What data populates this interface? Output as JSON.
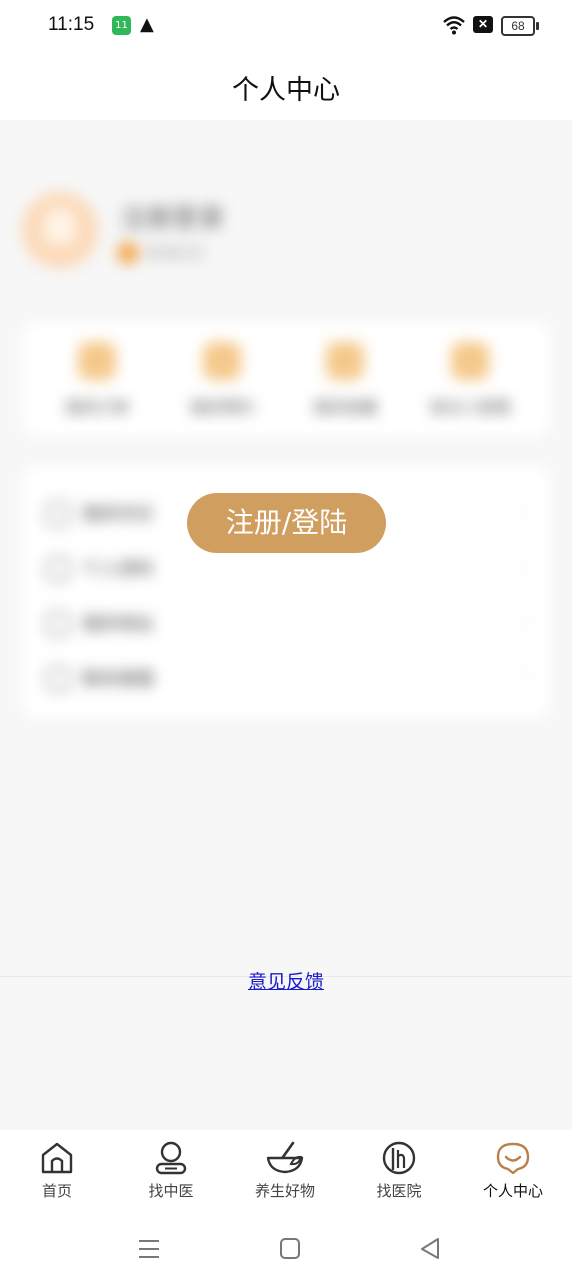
{
  "status_bar": {
    "time": "11:15",
    "app_badge": "11",
    "warning_icon": "warning-icon",
    "battery": "68"
  },
  "header": {
    "title": "个人中心"
  },
  "profile": {
    "nickname": "注册登录",
    "level": "普通会员"
  },
  "quick_actions": [
    {
      "label": "我的订单",
      "icon": "order-icon"
    },
    {
      "label": "我的预约",
      "icon": "appointment-icon"
    },
    {
      "label": "我的收藏",
      "icon": "favorite-icon"
    },
    {
      "label": "就诊人管理",
      "icon": "patient-icon"
    }
  ],
  "menu": [
    {
      "label": "我的问诊"
    },
    {
      "label": "个人资料"
    },
    {
      "label": "我的地址"
    },
    {
      "label": "联系客服"
    }
  ],
  "login_button": {
    "label": "注册/登陆"
  },
  "feedback": {
    "label": "意见反馈"
  },
  "tabs": [
    {
      "label": "首页",
      "icon": "home-icon"
    },
    {
      "label": "找中医",
      "icon": "doctor-icon"
    },
    {
      "label": "养生好物",
      "icon": "mortar-icon"
    },
    {
      "label": "找医院",
      "icon": "hospital-icon"
    },
    {
      "label": "个人中心",
      "icon": "profile-icon",
      "active": true
    }
  ],
  "colors": {
    "accent": "#d09e5e",
    "active_tab_icon": "#b9804a",
    "link": "#1a1acc"
  }
}
